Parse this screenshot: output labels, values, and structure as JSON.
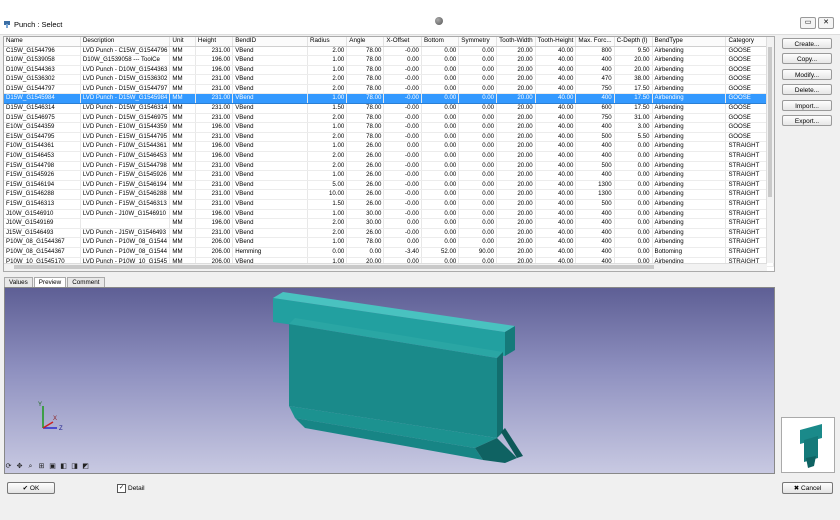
{
  "window": {
    "title": "Punch : Select"
  },
  "columns": [
    "Name",
    "Description",
    "Unit",
    "Height",
    "BendID",
    "Radius",
    "Angle",
    "X-Offset",
    "Bottom",
    "Symmetry",
    "Tooth-Width",
    "Tooth-Height",
    "Max. Forc...",
    "C-Depth (l)",
    "BendType",
    "Category"
  ],
  "rows": [
    [
      "C15W_G1544796",
      "LVD Punch - C15W_G1544796",
      "MM",
      "231.00",
      "VBend",
      "2.00",
      "78.00",
      "-0.00",
      "0.00",
      "0.00",
      "20.00",
      "40.00",
      "800",
      "9.50",
      "Airbending",
      "GOOSE"
    ],
    [
      "D10W_G1539058",
      "D10W_G1539058 --- ToolCe",
      "MM",
      "196.00",
      "VBend",
      "1.00",
      "78.00",
      "0.00",
      "0.00",
      "0.00",
      "20.00",
      "40.00",
      "400",
      "20.00",
      "Airbending",
      "GOOSE"
    ],
    [
      "D10W_G1544363",
      "LVD Punch - D10W_G1544363",
      "MM",
      "196.00",
      "VBend",
      "1.00",
      "78.00",
      "-0.00",
      "0.00",
      "0.00",
      "20.00",
      "40.00",
      "400",
      "20.00",
      "Airbending",
      "GOOSE"
    ],
    [
      "D15W_G1536302",
      "LVD Punch - D15W_G1536302",
      "MM",
      "231.00",
      "VBend",
      "2.00",
      "78.00",
      "-0.00",
      "0.00",
      "0.00",
      "20.00",
      "40.00",
      "470",
      "38.00",
      "Airbending",
      "GOOSE"
    ],
    [
      "D15W_G1544797",
      "LVD Punch - D15W_G1544797",
      "MM",
      "231.00",
      "VBend",
      "2.00",
      "78.00",
      "-0.00",
      "0.00",
      "0.00",
      "20.00",
      "40.00",
      "750",
      "17.50",
      "Airbending",
      "GOOSE"
    ],
    [
      "D15W_G1545984",
      "LVD Punch - D15W_G1545984",
      "MM",
      "231.00",
      "VBend",
      "1.00",
      "78.00",
      "-0.00",
      "0.00",
      "0.00",
      "20.00",
      "40.00",
      "400",
      "17.50",
      "Airbending",
      "GOOSE"
    ],
    [
      "D15W_G1546314",
      "LVD Punch - D15W_G1546314",
      "MM",
      "231.00",
      "VBend",
      "1.50",
      "78.00",
      "-0.00",
      "0.00",
      "0.00",
      "20.00",
      "40.00",
      "600",
      "17.50",
      "Airbending",
      "GOOSE"
    ],
    [
      "D15W_G1546975",
      "LVD Punch - D15W_G1546975",
      "MM",
      "231.00",
      "VBend",
      "2.00",
      "78.00",
      "-0.00",
      "0.00",
      "0.00",
      "20.00",
      "40.00",
      "750",
      "31.00",
      "Airbending",
      "GOOSE"
    ],
    [
      "E10W_G1544359",
      "LVD Punch - E10W_G1544359",
      "MM",
      "196.00",
      "VBend",
      "1.00",
      "78.00",
      "-0.00",
      "0.00",
      "0.00",
      "20.00",
      "40.00",
      "400",
      "3.00",
      "Airbending",
      "GOOSE"
    ],
    [
      "E15W_G1544795",
      "LVD Punch - E15W_G1544795",
      "MM",
      "231.00",
      "VBend",
      "2.00",
      "78.00",
      "-0.00",
      "0.00",
      "0.00",
      "20.00",
      "40.00",
      "500",
      "5.50",
      "Airbending",
      "GOOSE"
    ],
    [
      "F10W_G1544361",
      "LVD Punch - F10W_G1544361",
      "MM",
      "196.00",
      "VBend",
      "1.00",
      "26.00",
      "0.00",
      "0.00",
      "0.00",
      "20.00",
      "40.00",
      "400",
      "0.00",
      "Airbending",
      "STRAIGHT"
    ],
    [
      "F10W_G1546453",
      "LVD Punch - F10W_G1546453",
      "MM",
      "196.00",
      "VBend",
      "2.00",
      "26.00",
      "-0.00",
      "0.00",
      "0.00",
      "20.00",
      "40.00",
      "400",
      "0.00",
      "Airbending",
      "STRAIGHT"
    ],
    [
      "F15W_G1544798",
      "LVD Punch - F15W_G1544798",
      "MM",
      "231.00",
      "VBend",
      "2.00",
      "26.00",
      "-0.00",
      "0.00",
      "0.00",
      "20.00",
      "40.00",
      "500",
      "0.00",
      "Airbending",
      "STRAIGHT"
    ],
    [
      "F15W_G1545926",
      "LVD Punch - F15W_G1545926",
      "MM",
      "231.00",
      "VBend",
      "1.00",
      "26.00",
      "-0.00",
      "0.00",
      "0.00",
      "20.00",
      "40.00",
      "400",
      "0.00",
      "Airbending",
      "STRAIGHT"
    ],
    [
      "F15W_G1546194",
      "LVD Punch - F15W_G1546194",
      "MM",
      "231.00",
      "VBend",
      "5.00",
      "26.00",
      "-0.00",
      "0.00",
      "0.00",
      "20.00",
      "40.00",
      "1300",
      "0.00",
      "Airbending",
      "STRAIGHT"
    ],
    [
      "F15W_G1546288",
      "LVD Punch - F15W_G1546288",
      "MM",
      "231.00",
      "VBend",
      "10.00",
      "26.00",
      "-0.00",
      "0.00",
      "0.00",
      "20.00",
      "40.00",
      "1300",
      "0.00",
      "Airbending",
      "STRAIGHT"
    ],
    [
      "F15W_G1546313",
      "LVD Punch - F15W_G1546313",
      "MM",
      "231.00",
      "VBend",
      "1.50",
      "26.00",
      "-0.00",
      "0.00",
      "0.00",
      "20.00",
      "40.00",
      "500",
      "0.00",
      "Airbending",
      "STRAIGHT"
    ],
    [
      "J10W_G1546910",
      "LVD Punch - J10W_G1546910",
      "MM",
      "196.00",
      "VBend",
      "1.00",
      "30.00",
      "-0.00",
      "0.00",
      "0.00",
      "20.00",
      "40.00",
      "400",
      "0.00",
      "Airbending",
      "STRAIGHT"
    ],
    [
      "J10W_G1549169",
      "",
      "MM",
      "196.00",
      "VBend",
      "2.00",
      "30.00",
      "0.00",
      "0.00",
      "0.00",
      "20.00",
      "40.00",
      "400",
      "0.00",
      "Airbending",
      "STRAIGHT"
    ],
    [
      "J15W_G1546493",
      "LVD Punch - J15W_G1546493",
      "MM",
      "231.00",
      "VBend",
      "2.00",
      "26.00",
      "-0.00",
      "0.00",
      "0.00",
      "20.00",
      "40.00",
      "400",
      "0.00",
      "Airbending",
      "STRAIGHT"
    ],
    [
      "P10W_08_G1544367",
      "LVD Punch - P10W_08_G1544",
      "MM",
      "206.00",
      "VBend",
      "1.00",
      "78.00",
      "0.00",
      "0.00",
      "0.00",
      "20.00",
      "40.00",
      "400",
      "0.00",
      "Airbending",
      "STRAIGHT"
    ],
    [
      "P10W_08_G1544367",
      "LVD Punch - P10W_08_G1544",
      "MM",
      "206.00",
      "Hemming",
      "0.00",
      "0.00",
      "-3.40",
      "52.00",
      "90.00",
      "20.00",
      "40.00",
      "400",
      "0.00",
      "Bottoming",
      "STRAIGHT"
    ],
    [
      "P10W_10_G1545170",
      "LVD Punch - P10W_10_G1545",
      "MM",
      "206.00",
      "VBend",
      "1.00",
      "20.00",
      "0.00",
      "0.00",
      "0.00",
      "20.00",
      "40.00",
      "400",
      "0.00",
      "Airbending",
      "STRAIGHT"
    ]
  ],
  "selected_row": 5,
  "side_buttons": [
    "Create...",
    "Copy...",
    "Modify...",
    "Delete...",
    "Import...",
    "Export..."
  ],
  "tabs": [
    "Values",
    "Preview",
    "Comment"
  ],
  "active_tab": "Preview",
  "axis_labels": {
    "x": "X",
    "y": "Y",
    "z": "Z"
  },
  "footer": {
    "ok": "OK",
    "cancel": "Cancel",
    "detail": "Detail",
    "detail_checked": true
  },
  "colors": {
    "selection": "#3399ff",
    "tool_body": "#1a8a8a",
    "viewer_top": "#5e5f95",
    "viewer_bottom": "#c8c9e2"
  },
  "icons": [
    "punch-app-icon",
    "window-restore-icon",
    "window-close-icon",
    "rotate-icon",
    "zoom-icon",
    "fit-icon",
    "view-front-icon",
    "view-side-icon",
    "view-iso-icon"
  ]
}
